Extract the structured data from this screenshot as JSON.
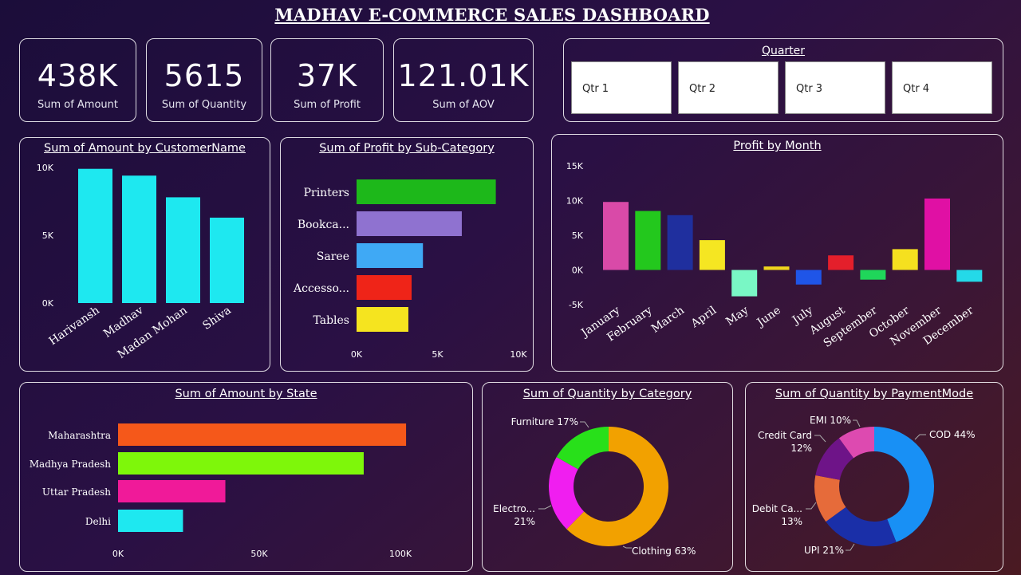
{
  "dashboard": {
    "title": "MADHAV E-COMMERCE SALES DASHBOARD"
  },
  "kpis": [
    {
      "value": "438K",
      "label": "Sum of Amount"
    },
    {
      "value": "5615",
      "label": "Sum of Quantity"
    },
    {
      "value": "37K",
      "label": "Sum of Profit"
    },
    {
      "value": "121.01K",
      "label": "Sum of AOV"
    }
  ],
  "quarter_slicer": {
    "title": "Quarter",
    "options": [
      "Qtr 1",
      "Qtr 2",
      "Qtr 3",
      "Qtr 4"
    ]
  },
  "panels": {
    "customer": "Sum of Amount by CustomerName",
    "subcategory": "Sum of Profit by Sub-Category",
    "month": "Profit by Month",
    "state": "Sum of Amount by State",
    "category": "Sum of Quantity by Category",
    "payment": "Sum of Quantity by PaymentMode"
  },
  "chart_data": [
    {
      "type": "bar",
      "title": "Sum of Amount by CustomerName",
      "categories": [
        "Harivansh",
        "Madhav",
        "Madan Mohan",
        "Shiva"
      ],
      "values": [
        9900,
        9400,
        7800,
        6300
      ],
      "yticks": [
        "0K",
        "5K",
        "10K"
      ],
      "ylim": [
        0,
        10000
      ],
      "color": "#1ee8f0"
    },
    {
      "type": "bar",
      "orientation": "horizontal",
      "title": "Sum of Profit by Sub-Category",
      "categories": [
        "Printers",
        "Bookca...",
        "Saree",
        "Accesso...",
        "Tables"
      ],
      "values": [
        8600,
        6500,
        4100,
        3400,
        3200
      ],
      "colors": [
        "#1db81a",
        "#8f72d0",
        "#3fa9f5",
        "#ef2418",
        "#f5e41f"
      ],
      "xticks": [
        "0K",
        "5K",
        "10K"
      ],
      "xlim": [
        0,
        10000
      ]
    },
    {
      "type": "bar",
      "title": "Profit by Month",
      "categories": [
        "January",
        "February",
        "March",
        "April",
        "May",
        "June",
        "July",
        "August",
        "September",
        "October",
        "November",
        "December"
      ],
      "values": [
        9800,
        8500,
        7900,
        4300,
        -3800,
        500,
        -2100,
        2100,
        -1400,
        3000,
        10300,
        -1700
      ],
      "colors": [
        "#d94aa8",
        "#23c81d",
        "#1f2f9e",
        "#f5e622",
        "#79f7c5",
        "#f0d61c",
        "#1f55e8",
        "#e41f2b",
        "#1fd65a",
        "#f5e01f",
        "#e010a4",
        "#24d9e8"
      ],
      "yticks": [
        "-5K",
        "0K",
        "5K",
        "10K",
        "15K"
      ],
      "ylim": [
        -5000,
        15000
      ]
    },
    {
      "type": "bar",
      "orientation": "horizontal",
      "title": "Sum of Amount by State",
      "categories": [
        "Maharashtra",
        "Madhya Pradesh",
        "Uttar Pradesh",
        "Delhi"
      ],
      "values": [
        102000,
        87000,
        38000,
        23000
      ],
      "colors": [
        "#f5581a",
        "#7ef70a",
        "#f01a99",
        "#1ee8f0"
      ],
      "xticks": [
        "0K",
        "50K",
        "100K"
      ],
      "xlim": [
        0,
        100000
      ]
    },
    {
      "type": "pie",
      "donut": true,
      "title": "Sum of Quantity by Category",
      "slices": [
        {
          "label": "Clothing 63%",
          "value": 63,
          "color": "#f2a100"
        },
        {
          "label": "Electro... 21%",
          "value": 21,
          "color": "#f01ef0"
        },
        {
          "label": "Furniture 17%",
          "value": 17,
          "color": "#28e01a"
        }
      ]
    },
    {
      "type": "pie",
      "donut": true,
      "title": "Sum of Quantity by PaymentMode",
      "slices": [
        {
          "label": "COD 44%",
          "value": 44,
          "color": "#1890f5"
        },
        {
          "label": "UPI 21%",
          "value": 21,
          "color": "#1a2fa8"
        },
        {
          "label": "Debit Ca... 13%",
          "value": 13,
          "color": "#e66b3a"
        },
        {
          "label": "Credit Card 12%",
          "value": 12,
          "color": "#6e1488"
        },
        {
          "label": "EMI 10%",
          "value": 10,
          "color": "#dd4ab0"
        }
      ]
    }
  ]
}
